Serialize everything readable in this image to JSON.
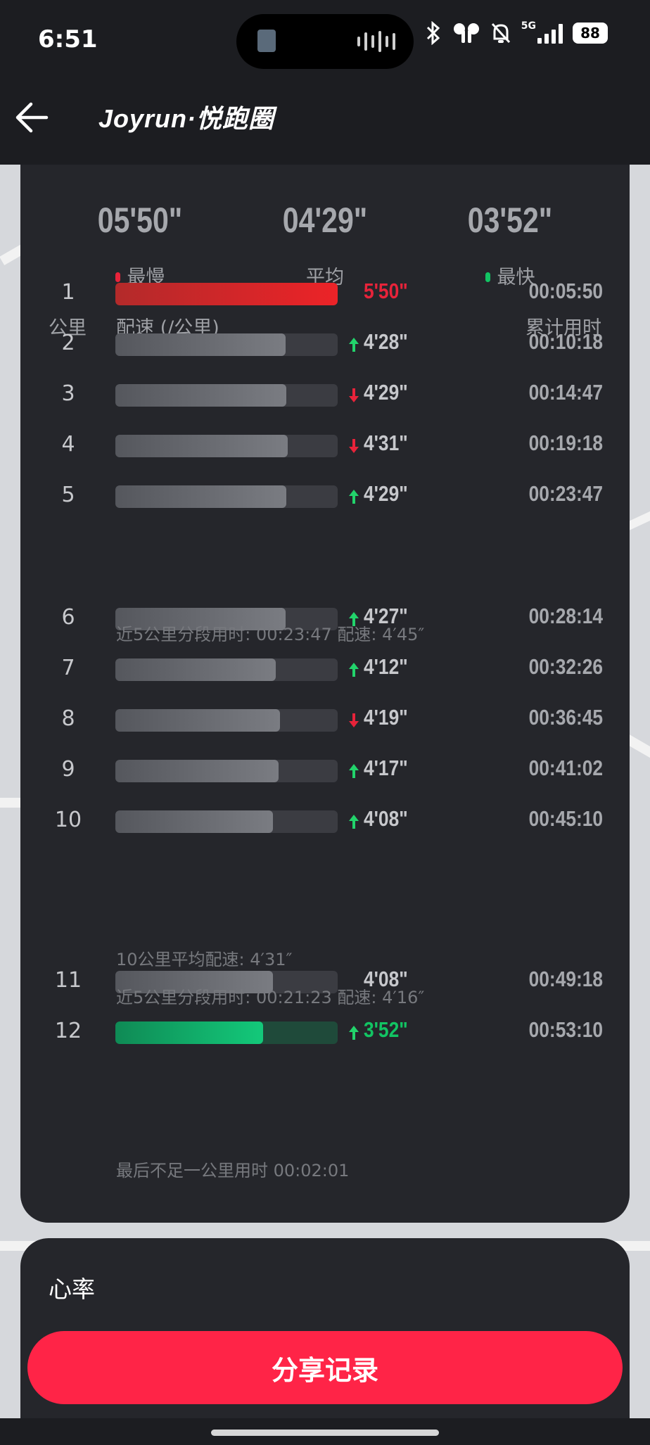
{
  "status_bar": {
    "time": "6:51",
    "network": "5G",
    "battery": "88",
    "icons": [
      "bluetooth-icon",
      "earbuds-icon",
      "bell-off-icon",
      "signal-icon",
      "battery-icon"
    ]
  },
  "header": {
    "back_icon": "arrow-left-icon",
    "brand": "Joyrun·悦跑圈"
  },
  "summary": {
    "slowest": {
      "value": "05'50\"",
      "label": "最慢",
      "dot_color": "#e8233a"
    },
    "average": {
      "value": "04'29\"",
      "label": "平均"
    },
    "fastest": {
      "value": "03'52\"",
      "label": "最快",
      "dot_color": "#12c463"
    }
  },
  "columns": {
    "km": "公里",
    "pace": "配速 (/公里)",
    "cumulative": "累计用时"
  },
  "splits": [
    {
      "km": "1",
      "pace": "5'50\"",
      "cumulative": "00:05:50",
      "trend": "",
      "bar_fraction": 1.0,
      "highlight": "slowest"
    },
    {
      "km": "2",
      "pace": "4'28\"",
      "cumulative": "00:10:18",
      "trend": "up",
      "bar_fraction": 0.765
    },
    {
      "km": "3",
      "pace": "4'29\"",
      "cumulative": "00:14:47",
      "trend": "down",
      "bar_fraction": 0.77
    },
    {
      "km": "4",
      "pace": "4'31\"",
      "cumulative": "00:19:18",
      "trend": "down",
      "bar_fraction": 0.775
    },
    {
      "km": "5",
      "pace": "4'29\"",
      "cumulative": "00:23:47",
      "trend": "up",
      "bar_fraction": 0.77
    },
    {
      "km": "6",
      "pace": "4'27\"",
      "cumulative": "00:28:14",
      "trend": "up",
      "bar_fraction": 0.765
    },
    {
      "km": "7",
      "pace": "4'12\"",
      "cumulative": "00:32:26",
      "trend": "up",
      "bar_fraction": 0.72
    },
    {
      "km": "8",
      "pace": "4'19\"",
      "cumulative": "00:36:45",
      "trend": "down",
      "bar_fraction": 0.74
    },
    {
      "km": "9",
      "pace": "4'17\"",
      "cumulative": "00:41:02",
      "trend": "up",
      "bar_fraction": 0.735
    },
    {
      "km": "10",
      "pace": "4'08\"",
      "cumulative": "00:45:10",
      "trend": "up",
      "bar_fraction": 0.71
    },
    {
      "km": "11",
      "pace": "4'08\"",
      "cumulative": "00:49:18",
      "trend": "",
      "bar_fraction": 0.71
    },
    {
      "km": "12",
      "pace": "3'52\"",
      "cumulative": "00:53:10",
      "trend": "up",
      "bar_fraction": 0.665,
      "highlight": "fastest"
    }
  ],
  "notes": {
    "after5": "近5公里分段用时: 00:23:47   配速: 4′45″",
    "after10_avg": "10公里平均配速: 4′31″",
    "after10_seg": "近5公里分段用时: 00:21:23   配速: 4′16″",
    "last": "最后不足一公里用时 00:02:01"
  },
  "heart_rate": {
    "title": "心率"
  },
  "share_button": "分享记录",
  "colors": {
    "slow": "#e8233a",
    "fast": "#12c463",
    "up_arrow": "#22d36b",
    "down_arrow": "#e8233a",
    "accent": "#ff2447"
  }
}
